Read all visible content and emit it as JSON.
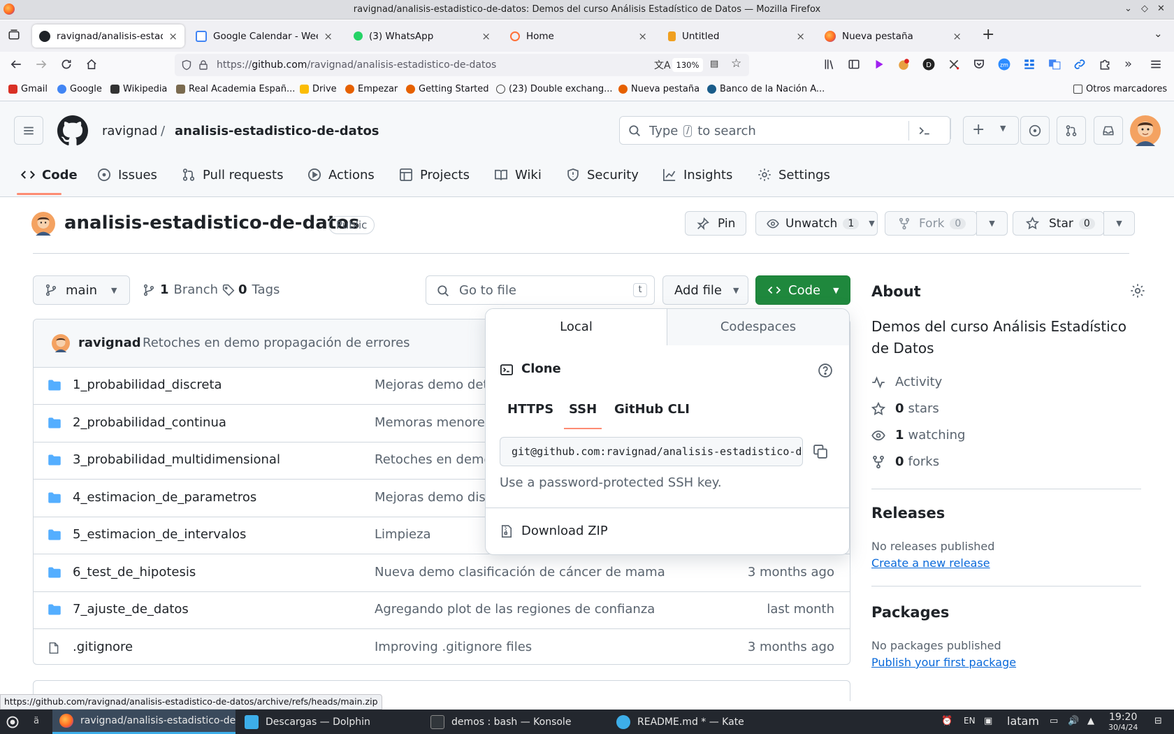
{
  "window": {
    "title": "ravignad/analisis-estadistico-de-datos: Demos del curso Análisis Estadístico de Datos — Mozilla Firefox"
  },
  "browser": {
    "tabs": [
      {
        "label": "ravignad/analisis-estadistic",
        "favicon": "github-icon",
        "active": true
      },
      {
        "label": "Google Calendar - Week of",
        "favicon": "calendar-icon",
        "active": false
      },
      {
        "label": "(3) WhatsApp",
        "favicon": "whatsapp-icon",
        "active": false
      },
      {
        "label": "Home",
        "favicon": "home-ring-icon",
        "active": false
      },
      {
        "label": "Untitled",
        "favicon": "document-icon",
        "active": false
      },
      {
        "label": "Nueva pestaña",
        "favicon": "firefox-icon",
        "active": false
      }
    ],
    "url_prefix": "https://",
    "url_host": "github.com",
    "url_path": "/ravignad/analisis-estadistico-de-datos",
    "zoom": "130%",
    "bookmarks": [
      {
        "label": "Gmail",
        "color": "#d93025"
      },
      {
        "label": "Google",
        "color": "#4285f4"
      },
      {
        "label": "Wikipedia",
        "color": "#333333"
      },
      {
        "label": "Real Academia Españ...",
        "color": "#7a6a4f"
      },
      {
        "label": "Drive",
        "color": "#fbbc04"
      },
      {
        "label": "Empezar",
        "color": "#e66000"
      },
      {
        "label": "Getting Started",
        "color": "#e66000"
      },
      {
        "label": "(23) Double exchang...",
        "color": "#444444"
      },
      {
        "label": "Nueva pestaña",
        "color": "#e66000"
      },
      {
        "label": "Banco de la Nación A...",
        "color": "#1a5c8a"
      }
    ],
    "other_bookmarks": "Otros marcadores"
  },
  "github": {
    "owner": "ravignad",
    "repo": "analisis-estadistico-de-datos",
    "search_prefix": "Type",
    "search_key": "/",
    "search_suffix": "to search",
    "nav": [
      "Code",
      "Issues",
      "Pull requests",
      "Actions",
      "Projects",
      "Wiki",
      "Security",
      "Insights",
      "Settings"
    ],
    "visibility": "Public",
    "pin_label": "Pin",
    "unwatch_label": "Unwatch",
    "unwatch_count": "1",
    "fork_label": "Fork",
    "fork_count": "0",
    "star_label": "Star",
    "star_count": "0",
    "branch_name": "main",
    "branch_count": "1",
    "branch_label": "Branch",
    "tag_count": "0",
    "tag_label": "Tags",
    "goto_placeholder": "Go to file",
    "goto_key": "t",
    "add_file_label": "Add file",
    "code_button_label": "Code",
    "commit": {
      "author": "ravignad",
      "message": "Retoches en demo propagación de errores"
    },
    "files": [
      {
        "name": "1_probabilidad_discreta",
        "type": "folder",
        "message": "Mejoras demo dete",
        "age": ""
      },
      {
        "name": "2_probabilidad_continua",
        "type": "folder",
        "message": "Memoras menores",
        "age": ""
      },
      {
        "name": "3_probabilidad_multidimensional",
        "type": "folder",
        "message": "Retoches en demo",
        "age": ""
      },
      {
        "name": "4_estimacion_de_parametros",
        "type": "folder",
        "message": "Mejoras demo dist",
        "age": ""
      },
      {
        "name": "5_estimacion_de_intervalos",
        "type": "folder",
        "message": "Limpieza",
        "age": ""
      },
      {
        "name": "6_test_de_hipotesis",
        "type": "folder",
        "message": "Nueva demo clasificación de cáncer de mama",
        "age": "3 months ago"
      },
      {
        "name": "7_ajuste_de_datos",
        "type": "folder",
        "message": "Agregando plot de las regiones de confianza",
        "age": "last month"
      },
      {
        "name": ".gitignore",
        "type": "file",
        "message": "Improving .gitignore files",
        "age": "3 months ago"
      }
    ],
    "dropdown": {
      "tab_local": "Local",
      "tab_codespaces": "Codespaces",
      "clone_label": "Clone",
      "protocols": [
        "HTTPS",
        "SSH",
        "GitHub CLI"
      ],
      "selected_protocol": "SSH",
      "clone_url": "git@github.com:ravignad/analisis-estadistico-de-datos.git",
      "ssh_hint": "Use a password-protected SSH key.",
      "download_zip": "Download ZIP"
    },
    "about": {
      "heading": "About",
      "description": "Demos del curso Análisis Estadístico de Datos",
      "activity": "Activity",
      "stars_count": "0",
      "stars_label": "stars",
      "watching_count": "1",
      "watching_label": "watching",
      "forks_count": "0",
      "forks_label": "forks"
    },
    "releases": {
      "heading": "Releases",
      "empty": "No releases published",
      "link": "Create a new release"
    },
    "packages": {
      "heading": "Packages",
      "empty": "No packages published",
      "link": "Publish your first package"
    }
  },
  "status_url": "https://github.com/ravignad/analisis-estadistico-de-datos/archive/refs/heads/main.zip",
  "taskbar": {
    "tasks": [
      {
        "label": "ravignad/analisis-estadistico-de-da...",
        "icon": "firefox-icon",
        "active": true
      },
      {
        "label": "Descargas — Dolphin",
        "icon": "folder-icon",
        "active": false
      },
      {
        "label": "demos : bash — Konsole",
        "icon": "terminal-icon",
        "active": false
      },
      {
        "label": "README.md * — Kate",
        "icon": "kate-icon",
        "active": false
      }
    ],
    "lang": "EN",
    "keyboard": "latam",
    "time": "19:20",
    "date": "30/4/24"
  },
  "colors": {
    "accent_green": "#1f883d",
    "link_blue": "#0969da",
    "folder_blue": "#54aeff",
    "tab_underline": "#fd8c73"
  }
}
